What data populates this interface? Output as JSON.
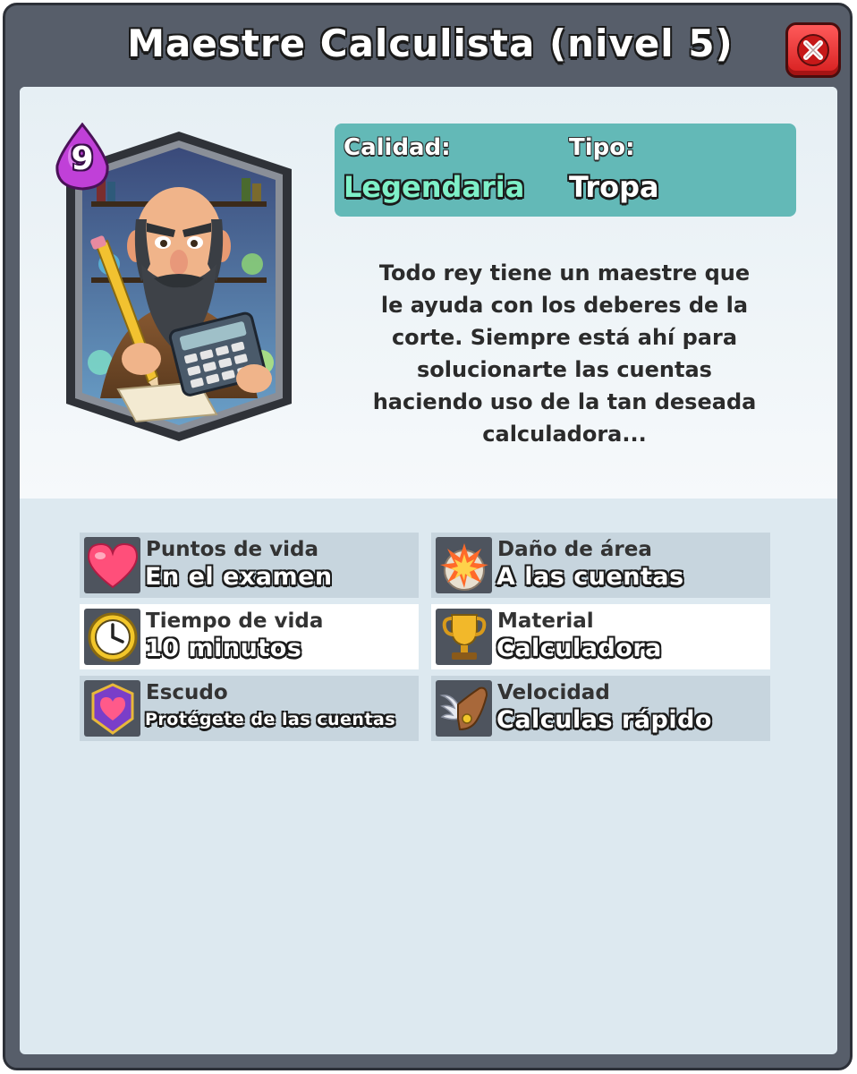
{
  "window": {
    "title": "Maestre Calculista (nivel 5)",
    "close_icon": "close-x-icon"
  },
  "card": {
    "elixir_cost": "9",
    "portrait_icon": "bald-bearded-scholar-with-calculator-and-pencil"
  },
  "info": {
    "quality_label": "Calidad:",
    "quality_value": "Legendaria",
    "type_label": "Tipo:",
    "type_value": "Tropa"
  },
  "description": "Todo rey tiene un maestre que\nle ayuda con los deberes de la\ncorte. Siempre está ahí para\nsolucionarte las cuentas\nhaciendo uso de la tan deseada\ncalculadora...",
  "stats": [
    {
      "icon": "heart-icon",
      "label": "Puntos de vida",
      "value": "En el examen"
    },
    {
      "icon": "explosion-icon",
      "label": "Daño de área",
      "value": "A las cuentas"
    },
    {
      "icon": "clock-icon",
      "label": "Tiempo de vida",
      "value": "10 minutos"
    },
    {
      "icon": "trophy-icon",
      "label": "Material",
      "value": "Calculadora"
    },
    {
      "icon": "shield-icon",
      "label": "Escudo",
      "value": "Protégete de las cuentas"
    },
    {
      "icon": "winged-boot-icon",
      "label": "Velocidad",
      "value": "Calculas rápido"
    }
  ],
  "colors": {
    "legendary": "#7ef0c8",
    "info_box": "#63b9b7",
    "frame": "#575e6a",
    "close_button": "#e53030"
  }
}
